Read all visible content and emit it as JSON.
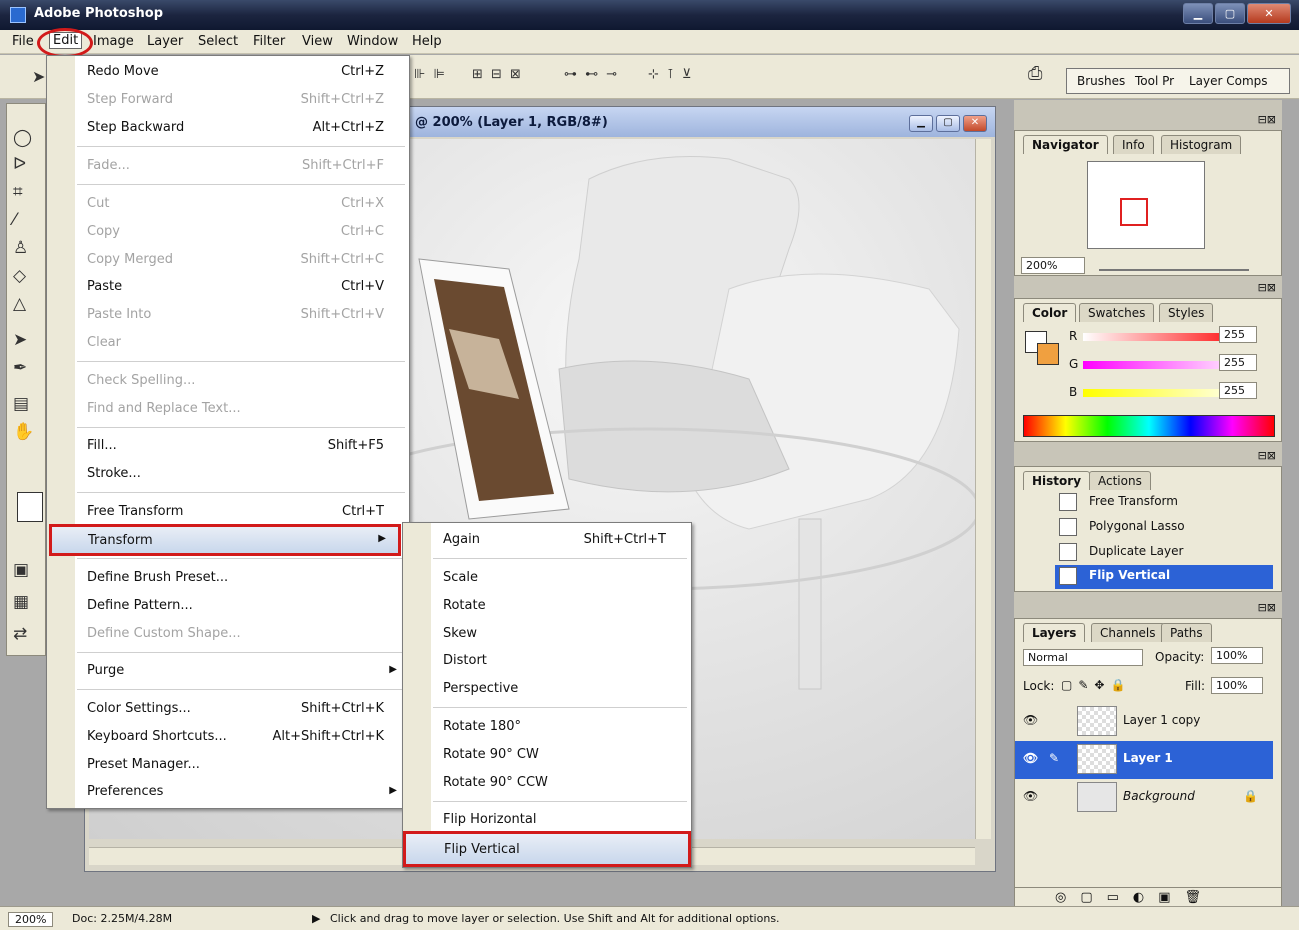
{
  "window": {
    "title": "Adobe Photoshop",
    "min": "▁",
    "max": "▢",
    "close": "✕"
  },
  "menubar": [
    "File",
    "Edit",
    "Image",
    "Layer",
    "Select",
    "Filter",
    "View",
    "Window",
    "Help"
  ],
  "optbar": {
    "glyphs": [
      "⊪ ⊫",
      "⊞ ⊟ ⊠",
      "⊶ ⊷ ⊸",
      "⊹ ⊺ ⊻"
    ]
  },
  "palette_well": [
    "Brushes",
    "Tool Pr",
    "Layer Comps"
  ],
  "document": {
    "title": "@ 200% (Layer 1, RGB/8#)"
  },
  "edit_menu": [
    {
      "label": "Redo Move",
      "shortcut": "Ctrl+Z",
      "disabled": false
    },
    {
      "label": "Step Forward",
      "shortcut": "Shift+Ctrl+Z",
      "disabled": true
    },
    {
      "label": "Step Backward",
      "shortcut": "Alt+Ctrl+Z",
      "disabled": false
    },
    {
      "label": "Fade...",
      "shortcut": "Shift+Ctrl+F",
      "disabled": true
    },
    {
      "label": "Cut",
      "shortcut": "Ctrl+X",
      "disabled": true
    },
    {
      "label": "Copy",
      "shortcut": "Ctrl+C",
      "disabled": true
    },
    {
      "label": "Copy Merged",
      "shortcut": "Shift+Ctrl+C",
      "disabled": true
    },
    {
      "label": "Paste",
      "shortcut": "Ctrl+V",
      "disabled": false
    },
    {
      "label": "Paste Into",
      "shortcut": "Shift+Ctrl+V",
      "disabled": true
    },
    {
      "label": "Clear",
      "shortcut": "",
      "disabled": true
    },
    {
      "label": "Check Spelling...",
      "shortcut": "",
      "disabled": true
    },
    {
      "label": "Find and Replace Text...",
      "shortcut": "",
      "disabled": true
    },
    {
      "label": "Fill...",
      "shortcut": "Shift+F5",
      "disabled": false
    },
    {
      "label": "Stroke...",
      "shortcut": "",
      "disabled": false
    },
    {
      "label": "Free Transform",
      "shortcut": "Ctrl+T",
      "disabled": false
    },
    {
      "label": "Transform",
      "shortcut": "",
      "disabled": false
    },
    {
      "label": "Define Brush Preset...",
      "shortcut": "",
      "disabled": false
    },
    {
      "label": "Define Pattern...",
      "shortcut": "",
      "disabled": false
    },
    {
      "label": "Define Custom Shape...",
      "shortcut": "",
      "disabled": true
    },
    {
      "label": "Purge",
      "shortcut": "",
      "disabled": false
    },
    {
      "label": "Color Settings...",
      "shortcut": "Shift+Ctrl+K",
      "disabled": false
    },
    {
      "label": "Keyboard Shortcuts...",
      "shortcut": "Alt+Shift+Ctrl+K",
      "disabled": false
    },
    {
      "label": "Preset Manager...",
      "shortcut": "",
      "disabled": false
    },
    {
      "label": "Preferences",
      "shortcut": "",
      "disabled": false
    }
  ],
  "transform_menu": [
    {
      "label": "Again",
      "shortcut": "Shift+Ctrl+T"
    },
    {
      "label": "Scale",
      "shortcut": ""
    },
    {
      "label": "Rotate",
      "shortcut": ""
    },
    {
      "label": "Skew",
      "shortcut": ""
    },
    {
      "label": "Distort",
      "shortcut": ""
    },
    {
      "label": "Perspective",
      "shortcut": ""
    },
    {
      "label": "Rotate 180°",
      "shortcut": ""
    },
    {
      "label": "Rotate 90° CW",
      "shortcut": ""
    },
    {
      "label": "Rotate 90° CCW",
      "shortcut": ""
    },
    {
      "label": "Flip Horizontal",
      "shortcut": ""
    },
    {
      "label": "Flip Vertical",
      "shortcut": ""
    }
  ],
  "navigator": {
    "tabs": [
      "Navigator",
      "Info",
      "Histogram"
    ],
    "zoom": "200%"
  },
  "color_panel": {
    "tabs": [
      "Color",
      "Swatches",
      "Styles"
    ],
    "channels": [
      {
        "name": "R",
        "value": "255"
      },
      {
        "name": "G",
        "value": "255"
      },
      {
        "name": "B",
        "value": "255"
      }
    ]
  },
  "history_panel": {
    "tabs": [
      "History",
      "Actions"
    ],
    "items": [
      "Free Transform",
      "Polygonal Lasso",
      "Duplicate Layer",
      "Flip Vertical"
    ]
  },
  "layers_panel": {
    "tabs": [
      "Layers",
      "Channels",
      "Paths"
    ],
    "blend_mode": "Normal",
    "opacity_label": "Opacity:",
    "opacity": "100%",
    "lock_label": "Lock:",
    "fill_label": "Fill:",
    "fill": "100%",
    "layers": [
      "Layer 1 copy",
      "Layer 1",
      "Background"
    ]
  },
  "status": {
    "zoom": "200%",
    "doc": "Doc: 2.25M/4.28M",
    "hint": "Click and drag to move layer or selection.  Use Shift and Alt for additional options."
  }
}
